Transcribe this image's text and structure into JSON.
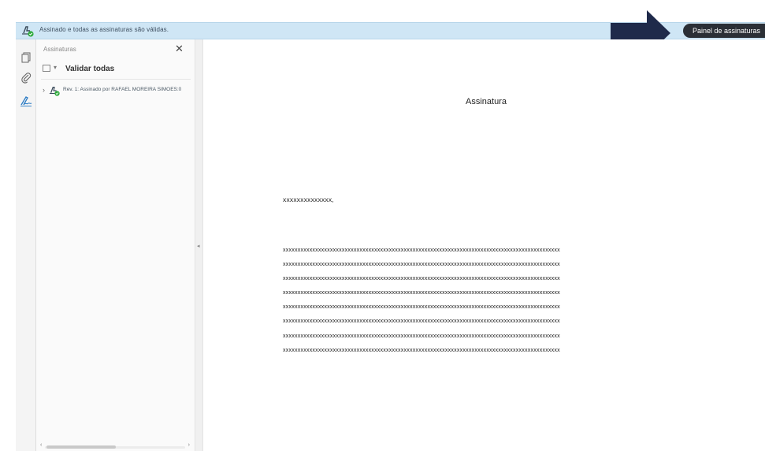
{
  "infobar": {
    "message": "Assinado e todas as assinaturas são válidas.",
    "panel_button": "Painel de assinaturas"
  },
  "rail": {
    "icons": [
      "pages-icon",
      "attachment-icon",
      "signature-icon"
    ]
  },
  "signatures_panel": {
    "title": "Assinaturas",
    "close": "✕",
    "options_caret": "▾",
    "validate_all": "Validar todas",
    "entry_chevron": "›",
    "entry": "Rev. 1: Assinado por RAFAEL MOREIRA SIMOES:0",
    "scroll_left": "‹",
    "scroll_right": "›"
  },
  "splitter": {
    "grip": "◂"
  },
  "document": {
    "heading": "Assinatura",
    "greeting": "xxxxxxxxxxxxxx,",
    "lines": [
      "xxxxxxxxxxxxxxxxxxxxxxxxxxxxxxxxxxxxxxxxxxxxxxxxxxxxxxxxxxxxxxxxxxxxxxxxxxxxxxxxxxxxxxxxxxxxxx",
      "xxxxxxxxxxxxxxxxxxxxxxxxxxxxxxxxxxxxxxxxxxxxxxxxxxxxxxxxxxxxxxxxxxxxxxxxxxxxxxxxxxxxxxxxxxxxxx",
      "xxxxxxxxxxxxxxxxxxxxxxxxxxxxxxxxxxxxxxxxxxxxxxxxxxxxxxxxxxxxxxxxxxxxxxxxxxxxxxxxxxxxxxxxxxxxxx",
      "xxxxxxxxxxxxxxxxxxxxxxxxxxxxxxxxxxxxxxxxxxxxxxxxxxxxxxxxxxxxxxxxxxxxxxxxxxxxxxxxxxxxxxxxxxxxxx",
      "xxxxxxxxxxxxxxxxxxxxxxxxxxxxxxxxxxxxxxxxxxxxxxxxxxxxxxxxxxxxxxxxxxxxxxxxxxxxxxxxxxxxxxxxxxxxxx",
      "xxxxxxxxxxxxxxxxxxxxxxxxxxxxxxxxxxxxxxxxxxxxxxxxxxxxxxxxxxxxxxxxxxxxxxxxxxxxxxxxxxxxxxxxxxxxxx",
      "xxxxxxxxxxxxxxxxxxxxxxxxxxxxxxxxxxxxxxxxxxxxxxxxxxxxxxxxxxxxxxxxxxxxxxxxxxxxxxxxxxxxxxxxxxxxxx",
      "xxxxxxxxxxxxxxxxxxxxxxxxxxxxxxxxxxxxxxxxxxxxxxxxxxxxxxxxxxxxxxxxxxxxxxxxxxxxxxxxxxxxxxxxxxxxxx"
    ]
  },
  "colors": {
    "infobar_bg": "#cfe6f5",
    "panel_button_bg": "#2b2f36",
    "arrow": "#1f2a4a",
    "valid_green": "#2eaa3c"
  }
}
